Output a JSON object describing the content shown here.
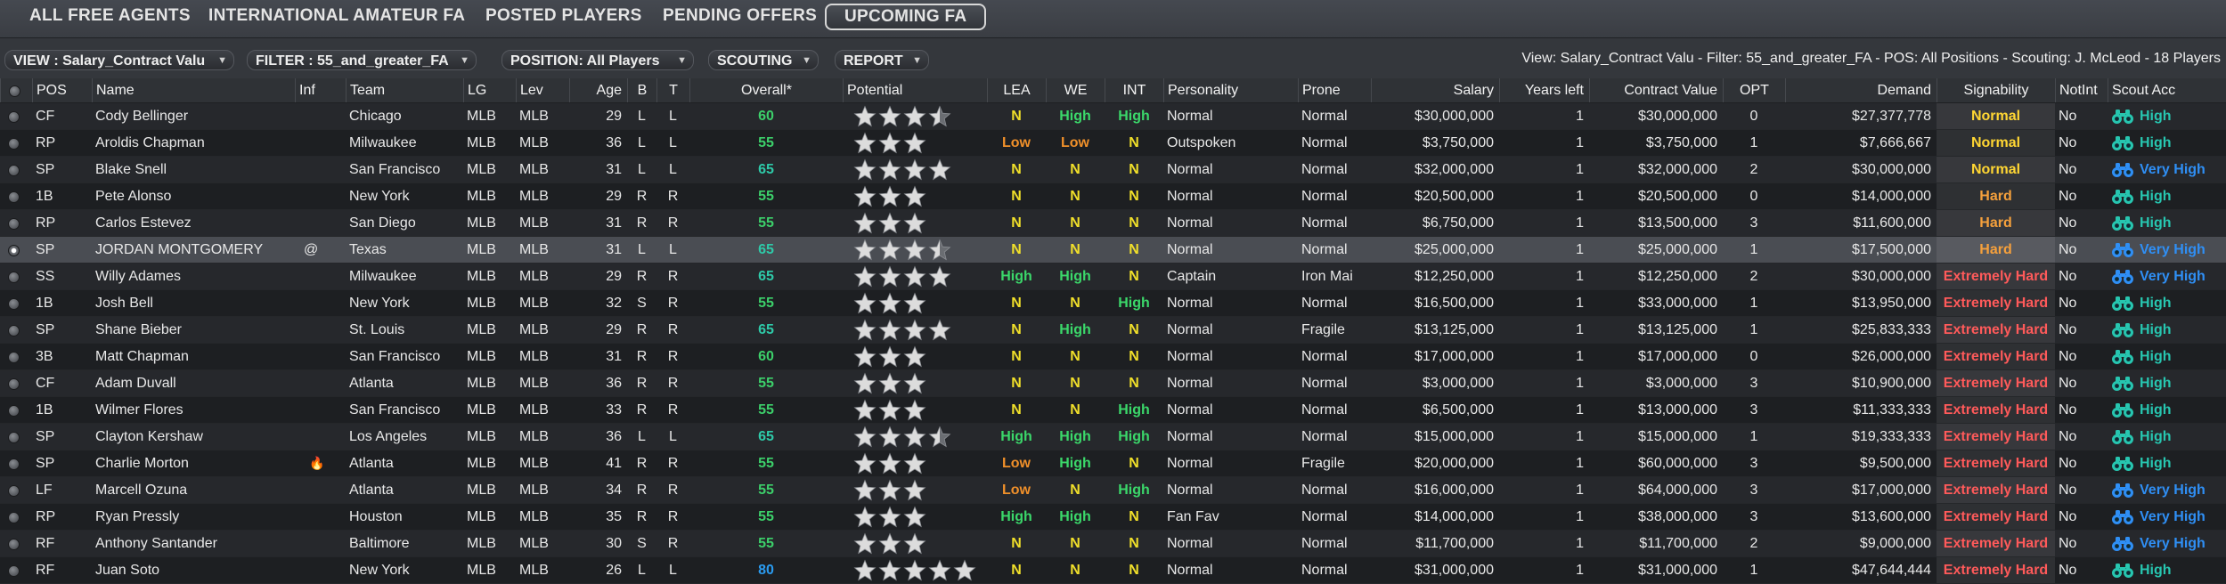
{
  "tabs": [
    {
      "label": "ALL FREE AGENTS",
      "active": false
    },
    {
      "label": "INTERNATIONAL AMATEUR FA",
      "active": false
    },
    {
      "label": "POSTED PLAYERS",
      "active": false
    },
    {
      "label": "PENDING OFFERS",
      "active": false
    },
    {
      "label": "UPCOMING FA",
      "active": true
    }
  ],
  "filters": {
    "view": "VIEW : Salary_Contract Valu",
    "filter": "FILTER : 55_and_greater_FA",
    "position": "POSITION: All Players",
    "scouting": "SCOUTING",
    "report": "REPORT"
  },
  "summary": "View: Salary_Contract Valu - Filter: 55_and_greater_FA - POS: All Positions - Scouting: J. McLeod - 18 Players",
  "columns": {
    "pos": "POS",
    "name": "Name",
    "inf": "Inf",
    "team": "Team",
    "lg": "LG",
    "lev": "Lev",
    "age": "Age",
    "b": "B",
    "t": "T",
    "overall": "Overall*",
    "potential": "Potential",
    "lea": "LEA",
    "we": "WE",
    "int": "INT",
    "personality": "Personality",
    "prone": "Prone",
    "salary": "Salary",
    "years_left": "Years left",
    "contract_value": "Contract Value",
    "opt": "OPT",
    "demand": "Demand",
    "signability": "Signability",
    "notint": "NotInt",
    "scout_acc": "Scout Acc"
  },
  "colors": {
    "rating_green": "#3bd86a",
    "rating_yellow": "#f0df2a",
    "rating_orange": "#f0902a",
    "sig_normal": "#ffd633",
    "sig_hard": "#f5a03c",
    "sig_extremely_hard": "#ff5a5a",
    "acc_high": "#27c6b0",
    "acc_very_high": "#2f8ff5"
  },
  "players": [
    {
      "pos": "CF",
      "name": "Cody Bellinger",
      "inf": "",
      "team": "Chicago",
      "lg": "MLB",
      "lev": "MLB",
      "age": "29",
      "b": "L",
      "t": "L",
      "overall": "60",
      "overall_color": "ov-g",
      "potential": 3.5,
      "lea": "N",
      "lea_c": "y",
      "we": "High",
      "we_c": "g",
      "int": "High",
      "int_c": "g",
      "personality": "Normal",
      "prone": "Normal",
      "salary": "$30,000,000",
      "years_left": "1",
      "contract_value": "$30,000,000",
      "opt": "0",
      "demand": "$27,377,778",
      "signability": "Normal",
      "sig_c": "sig-normal",
      "notint": "No",
      "scout_acc": "High",
      "acc_c": "acc-high",
      "selected": false
    },
    {
      "pos": "RP",
      "name": "Aroldis Chapman",
      "inf": "",
      "team": "Milwaukee",
      "lg": "MLB",
      "lev": "MLB",
      "age": "36",
      "b": "L",
      "t": "L",
      "overall": "55",
      "overall_color": "ov-g",
      "potential": 3,
      "lea": "Low",
      "lea_c": "o",
      "we": "Low",
      "we_c": "o",
      "int": "N",
      "int_c": "y",
      "personality": "Outspoken",
      "prone": "Normal",
      "salary": "$3,750,000",
      "years_left": "1",
      "contract_value": "$3,750,000",
      "opt": "1",
      "demand": "$7,666,667",
      "signability": "Normal",
      "sig_c": "sig-normal",
      "notint": "No",
      "scout_acc": "High",
      "acc_c": "acc-high",
      "selected": false
    },
    {
      "pos": "SP",
      "name": "Blake Snell",
      "inf": "",
      "team": "San Francisco",
      "lg": "MLB",
      "lev": "MLB",
      "age": "31",
      "b": "L",
      "t": "L",
      "overall": "65",
      "overall_color": "ov-t",
      "potential": 4,
      "lea": "N",
      "lea_c": "y",
      "we": "N",
      "we_c": "y",
      "int": "N",
      "int_c": "y",
      "personality": "Normal",
      "prone": "Normal",
      "salary": "$32,000,000",
      "years_left": "1",
      "contract_value": "$32,000,000",
      "opt": "2",
      "demand": "$30,000,000",
      "signability": "Normal",
      "sig_c": "sig-normal",
      "notint": "No",
      "scout_acc": "Very High",
      "acc_c": "acc-vhigh",
      "selected": false
    },
    {
      "pos": "1B",
      "name": "Pete Alonso",
      "inf": "",
      "team": "New York",
      "lg": "MLB",
      "lev": "MLB",
      "age": "29",
      "b": "R",
      "t": "R",
      "overall": "55",
      "overall_color": "ov-g",
      "potential": 3,
      "lea": "N",
      "lea_c": "y",
      "we": "N",
      "we_c": "y",
      "int": "N",
      "int_c": "y",
      "personality": "Normal",
      "prone": "Normal",
      "salary": "$20,500,000",
      "years_left": "1",
      "contract_value": "$20,500,000",
      "opt": "0",
      "demand": "$14,000,000",
      "signability": "Hard",
      "sig_c": "sig-hard",
      "notint": "No",
      "scout_acc": "High",
      "acc_c": "acc-high",
      "selected": false
    },
    {
      "pos": "RP",
      "name": "Carlos Estevez",
      "inf": "",
      "team": "San Diego",
      "lg": "MLB",
      "lev": "MLB",
      "age": "31",
      "b": "R",
      "t": "R",
      "overall": "55",
      "overall_color": "ov-g",
      "potential": 3,
      "lea": "N",
      "lea_c": "y",
      "we": "N",
      "we_c": "y",
      "int": "N",
      "int_c": "y",
      "personality": "Normal",
      "prone": "Normal",
      "salary": "$6,750,000",
      "years_left": "1",
      "contract_value": "$13,500,000",
      "opt": "3",
      "demand": "$11,600,000",
      "signability": "Hard",
      "sig_c": "sig-hard",
      "notint": "No",
      "scout_acc": "High",
      "acc_c": "acc-high",
      "selected": false
    },
    {
      "pos": "SP",
      "name": "JORDAN MONTGOMERY",
      "inf": "@",
      "team": "Texas",
      "lg": "MLB",
      "lev": "MLB",
      "age": "31",
      "b": "L",
      "t": "L",
      "overall": "65",
      "overall_color": "ov-t",
      "potential": 3.5,
      "lea": "N",
      "lea_c": "y",
      "we": "N",
      "we_c": "y",
      "int": "N",
      "int_c": "y",
      "personality": "Normal",
      "prone": "Normal",
      "salary": "$25,000,000",
      "years_left": "1",
      "contract_value": "$25,000,000",
      "opt": "1",
      "demand": "$17,500,000",
      "signability": "Hard",
      "sig_c": "sig-hard",
      "notint": "No",
      "scout_acc": "Very High",
      "acc_c": "acc-vhigh",
      "selected": true
    },
    {
      "pos": "SS",
      "name": "Willy Adames",
      "inf": "",
      "team": "Milwaukee",
      "lg": "MLB",
      "lev": "MLB",
      "age": "29",
      "b": "R",
      "t": "R",
      "overall": "65",
      "overall_color": "ov-t",
      "potential": 4,
      "lea": "High",
      "lea_c": "g",
      "we": "High",
      "we_c": "g",
      "int": "N",
      "int_c": "y",
      "personality": "Captain",
      "prone": "Iron Mai",
      "salary": "$12,250,000",
      "years_left": "1",
      "contract_value": "$12,250,000",
      "opt": "2",
      "demand": "$30,000,000",
      "signability": "Extremely Hard",
      "sig_c": "sig-xhard",
      "notint": "No",
      "scout_acc": "Very High",
      "acc_c": "acc-vhigh",
      "selected": false
    },
    {
      "pos": "1B",
      "name": "Josh Bell",
      "inf": "",
      "team": "New York",
      "lg": "MLB",
      "lev": "MLB",
      "age": "32",
      "b": "S",
      "t": "R",
      "overall": "55",
      "overall_color": "ov-g",
      "potential": 3,
      "lea": "N",
      "lea_c": "y",
      "we": "N",
      "we_c": "y",
      "int": "High",
      "int_c": "g",
      "personality": "Normal",
      "prone": "Normal",
      "salary": "$16,500,000",
      "years_left": "1",
      "contract_value": "$33,000,000",
      "opt": "1",
      "demand": "$13,950,000",
      "signability": "Extremely Hard",
      "sig_c": "sig-xhard",
      "notint": "No",
      "scout_acc": "High",
      "acc_c": "acc-high",
      "selected": false
    },
    {
      "pos": "SP",
      "name": "Shane Bieber",
      "inf": "",
      "team": "St. Louis",
      "lg": "MLB",
      "lev": "MLB",
      "age": "29",
      "b": "R",
      "t": "R",
      "overall": "65",
      "overall_color": "ov-t",
      "potential": 4,
      "lea": "N",
      "lea_c": "y",
      "we": "High",
      "we_c": "g",
      "int": "N",
      "int_c": "y",
      "personality": "Normal",
      "prone": "Fragile",
      "salary": "$13,125,000",
      "years_left": "1",
      "contract_value": "$13,125,000",
      "opt": "1",
      "demand": "$25,833,333",
      "signability": "Extremely Hard",
      "sig_c": "sig-xhard",
      "notint": "No",
      "scout_acc": "High",
      "acc_c": "acc-high",
      "selected": false
    },
    {
      "pos": "3B",
      "name": "Matt Chapman",
      "inf": "",
      "team": "San Francisco",
      "lg": "MLB",
      "lev": "MLB",
      "age": "31",
      "b": "R",
      "t": "R",
      "overall": "60",
      "overall_color": "ov-g",
      "potential": 3,
      "lea": "N",
      "lea_c": "y",
      "we": "N",
      "we_c": "y",
      "int": "N",
      "int_c": "y",
      "personality": "Normal",
      "prone": "Normal",
      "salary": "$17,000,000",
      "years_left": "1",
      "contract_value": "$17,000,000",
      "opt": "0",
      "demand": "$26,000,000",
      "signability": "Extremely Hard",
      "sig_c": "sig-xhard",
      "notint": "No",
      "scout_acc": "High",
      "acc_c": "acc-high",
      "selected": false
    },
    {
      "pos": "CF",
      "name": "Adam Duvall",
      "inf": "",
      "team": "Atlanta",
      "lg": "MLB",
      "lev": "MLB",
      "age": "36",
      "b": "R",
      "t": "R",
      "overall": "55",
      "overall_color": "ov-g",
      "potential": 3,
      "lea": "N",
      "lea_c": "y",
      "we": "N",
      "we_c": "y",
      "int": "N",
      "int_c": "y",
      "personality": "Normal",
      "prone": "Normal",
      "salary": "$3,000,000",
      "years_left": "1",
      "contract_value": "$3,000,000",
      "opt": "3",
      "demand": "$10,900,000",
      "signability": "Extremely Hard",
      "sig_c": "sig-xhard",
      "notint": "No",
      "scout_acc": "High",
      "acc_c": "acc-high",
      "selected": false
    },
    {
      "pos": "1B",
      "name": "Wilmer Flores",
      "inf": "",
      "team": "San Francisco",
      "lg": "MLB",
      "lev": "MLB",
      "age": "33",
      "b": "R",
      "t": "R",
      "overall": "55",
      "overall_color": "ov-g",
      "potential": 3,
      "lea": "N",
      "lea_c": "y",
      "we": "N",
      "we_c": "y",
      "int": "High",
      "int_c": "g",
      "personality": "Normal",
      "prone": "Normal",
      "salary": "$6,500,000",
      "years_left": "1",
      "contract_value": "$13,000,000",
      "opt": "3",
      "demand": "$11,333,333",
      "signability": "Extremely Hard",
      "sig_c": "sig-xhard",
      "notint": "No",
      "scout_acc": "High",
      "acc_c": "acc-high",
      "selected": false
    },
    {
      "pos": "SP",
      "name": "Clayton Kershaw",
      "inf": "",
      "team": "Los Angeles",
      "lg": "MLB",
      "lev": "MLB",
      "age": "36",
      "b": "L",
      "t": "L",
      "overall": "65",
      "overall_color": "ov-t",
      "potential": 3.5,
      "lea": "High",
      "lea_c": "g",
      "we": "High",
      "we_c": "g",
      "int": "High",
      "int_c": "g",
      "personality": "Normal",
      "prone": "Normal",
      "salary": "$15,000,000",
      "years_left": "1",
      "contract_value": "$15,000,000",
      "opt": "1",
      "demand": "$19,333,333",
      "signability": "Extremely Hard",
      "sig_c": "sig-xhard",
      "notint": "No",
      "scout_acc": "High",
      "acc_c": "acc-high",
      "selected": false
    },
    {
      "pos": "SP",
      "name": "Charlie Morton",
      "inf": "🔥",
      "team": "Atlanta",
      "lg": "MLB",
      "lev": "MLB",
      "age": "41",
      "b": "R",
      "t": "R",
      "overall": "55",
      "overall_color": "ov-g",
      "potential": 3,
      "lea": "Low",
      "lea_c": "o",
      "we": "High",
      "we_c": "g",
      "int": "N",
      "int_c": "y",
      "personality": "Normal",
      "prone": "Fragile",
      "salary": "$20,000,000",
      "years_left": "1",
      "contract_value": "$60,000,000",
      "opt": "3",
      "demand": "$9,500,000",
      "signability": "Extremely Hard",
      "sig_c": "sig-xhard",
      "notint": "No",
      "scout_acc": "High",
      "acc_c": "acc-high",
      "selected": false
    },
    {
      "pos": "LF",
      "name": "Marcell Ozuna",
      "inf": "",
      "team": "Atlanta",
      "lg": "MLB",
      "lev": "MLB",
      "age": "34",
      "b": "R",
      "t": "R",
      "overall": "55",
      "overall_color": "ov-g",
      "potential": 3,
      "lea": "Low",
      "lea_c": "o",
      "we": "N",
      "we_c": "y",
      "int": "High",
      "int_c": "g",
      "personality": "Normal",
      "prone": "Normal",
      "salary": "$16,000,000",
      "years_left": "1",
      "contract_value": "$64,000,000",
      "opt": "3",
      "demand": "$17,000,000",
      "signability": "Extremely Hard",
      "sig_c": "sig-xhard",
      "notint": "No",
      "scout_acc": "Very High",
      "acc_c": "acc-vhigh",
      "selected": false
    },
    {
      "pos": "RP",
      "name": "Ryan Pressly",
      "inf": "",
      "team": "Houston",
      "lg": "MLB",
      "lev": "MLB",
      "age": "35",
      "b": "R",
      "t": "R",
      "overall": "55",
      "overall_color": "ov-g",
      "potential": 3,
      "lea": "High",
      "lea_c": "g",
      "we": "High",
      "we_c": "g",
      "int": "N",
      "int_c": "y",
      "personality": "Fan Fav",
      "prone": "Normal",
      "salary": "$14,000,000",
      "years_left": "1",
      "contract_value": "$38,000,000",
      "opt": "3",
      "demand": "$13,600,000",
      "signability": "Extremely Hard",
      "sig_c": "sig-xhard",
      "notint": "No",
      "scout_acc": "Very High",
      "acc_c": "acc-vhigh",
      "selected": false
    },
    {
      "pos": "RF",
      "name": "Anthony Santander",
      "inf": "",
      "team": "Baltimore",
      "lg": "MLB",
      "lev": "MLB",
      "age": "30",
      "b": "S",
      "t": "R",
      "overall": "55",
      "overall_color": "ov-g",
      "potential": 3,
      "lea": "N",
      "lea_c": "y",
      "we": "N",
      "we_c": "y",
      "int": "N",
      "int_c": "y",
      "personality": "Normal",
      "prone": "Normal",
      "salary": "$11,700,000",
      "years_left": "1",
      "contract_value": "$11,700,000",
      "opt": "2",
      "demand": "$9,000,000",
      "signability": "Extremely Hard",
      "sig_c": "sig-xhard",
      "notint": "No",
      "scout_acc": "Very High",
      "acc_c": "acc-vhigh",
      "selected": false
    },
    {
      "pos": "RF",
      "name": "Juan Soto",
      "inf": "",
      "team": "New York",
      "lg": "MLB",
      "lev": "MLB",
      "age": "26",
      "b": "L",
      "t": "L",
      "overall": "80",
      "overall_color": "ov-b",
      "potential": 5,
      "lea": "N",
      "lea_c": "y",
      "we": "N",
      "we_c": "y",
      "int": "N",
      "int_c": "y",
      "personality": "Normal",
      "prone": "Normal",
      "salary": "$31,000,000",
      "years_left": "1",
      "contract_value": "$31,000,000",
      "opt": "1",
      "demand": "$47,644,444",
      "signability": "Extremely Hard",
      "sig_c": "sig-xhard",
      "notint": "No",
      "scout_acc": "High",
      "acc_c": "acc-high",
      "selected": false
    }
  ]
}
